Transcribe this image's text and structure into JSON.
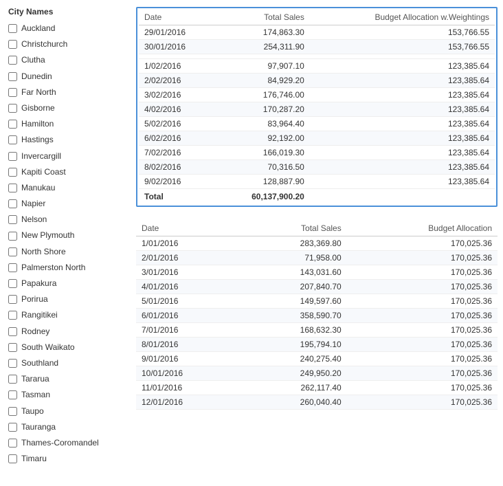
{
  "sidebar": {
    "title": "City Names",
    "cities": [
      {
        "name": "Auckland",
        "checked": false
      },
      {
        "name": "Christchurch",
        "checked": false
      },
      {
        "name": "Clutha",
        "checked": false
      },
      {
        "name": "Dunedin",
        "checked": false
      },
      {
        "name": "Far North",
        "checked": false
      },
      {
        "name": "Gisborne",
        "checked": false
      },
      {
        "name": "Hamilton",
        "checked": false
      },
      {
        "name": "Hastings",
        "checked": false
      },
      {
        "name": "Invercargill",
        "checked": false
      },
      {
        "name": "Kapiti Coast",
        "checked": false
      },
      {
        "name": "Manukau",
        "checked": false
      },
      {
        "name": "Napier",
        "checked": false
      },
      {
        "name": "Nelson",
        "checked": false
      },
      {
        "name": "New Plymouth",
        "checked": false
      },
      {
        "name": "North Shore",
        "checked": false
      },
      {
        "name": "Palmerston North",
        "checked": false
      },
      {
        "name": "Papakura",
        "checked": false
      },
      {
        "name": "Porirua",
        "checked": false
      },
      {
        "name": "Rangitikei",
        "checked": false
      },
      {
        "name": "Rodney",
        "checked": false
      },
      {
        "name": "South Waikato",
        "checked": false
      },
      {
        "name": "Southland",
        "checked": false
      },
      {
        "name": "Tararua",
        "checked": false
      },
      {
        "name": "Tasman",
        "checked": false
      },
      {
        "name": "Taupo",
        "checked": false
      },
      {
        "name": "Tauranga",
        "checked": false
      },
      {
        "name": "Thames-Coromandel",
        "checked": false
      },
      {
        "name": "Timaru",
        "checked": false
      }
    ]
  },
  "table1": {
    "headers": [
      "Date",
      "Total Sales",
      "Budget Allocation w.Weightings"
    ],
    "pre_rows": [
      {
        "date": "29/01/2016",
        "total_sales": "174,863.30",
        "budget": "153,766.55"
      },
      {
        "date": "30/01/2016",
        "total_sales": "254,311.90",
        "budget": "153,766.55"
      },
      {
        "date": "...",
        "total_sales": "...",
        "budget": "..."
      }
    ],
    "rows": [
      {
        "date": "1/02/2016",
        "total_sales": "97,907.10",
        "budget": "123,385.64"
      },
      {
        "date": "2/02/2016",
        "total_sales": "84,929.20",
        "budget": "123,385.64"
      },
      {
        "date": "3/02/2016",
        "total_sales": "176,746.00",
        "budget": "123,385.64"
      },
      {
        "date": "4/02/2016",
        "total_sales": "170,287.20",
        "budget": "123,385.64"
      },
      {
        "date": "5/02/2016",
        "total_sales": "83,964.40",
        "budget": "123,385.64"
      },
      {
        "date": "6/02/2016",
        "total_sales": "92,192.00",
        "budget": "123,385.64"
      },
      {
        "date": "7/02/2016",
        "total_sales": "166,019.30",
        "budget": "123,385.64"
      },
      {
        "date": "8/02/2016",
        "total_sales": "70,316.50",
        "budget": "123,385.64"
      },
      {
        "date": "9/02/2016",
        "total_sales": "128,887.90",
        "budget": "123,385.64"
      }
    ],
    "footer": {
      "label": "Total",
      "total_sales": "60,137,900.20",
      "budget": ""
    }
  },
  "table2": {
    "headers": [
      "Date",
      "Total Sales",
      "Budget Allocation"
    ],
    "rows": [
      {
        "date": "1/01/2016",
        "total_sales": "283,369.80",
        "budget": "170,025.36"
      },
      {
        "date": "2/01/2016",
        "total_sales": "71,958.00",
        "budget": "170,025.36"
      },
      {
        "date": "3/01/2016",
        "total_sales": "143,031.60",
        "budget": "170,025.36"
      },
      {
        "date": "4/01/2016",
        "total_sales": "207,840.70",
        "budget": "170,025.36"
      },
      {
        "date": "5/01/2016",
        "total_sales": "149,597.60",
        "budget": "170,025.36"
      },
      {
        "date": "6/01/2016",
        "total_sales": "358,590.70",
        "budget": "170,025.36"
      },
      {
        "date": "7/01/2016",
        "total_sales": "168,632.30",
        "budget": "170,025.36"
      },
      {
        "date": "8/01/2016",
        "total_sales": "195,794.10",
        "budget": "170,025.36"
      },
      {
        "date": "9/01/2016",
        "total_sales": "240,275.40",
        "budget": "170,025.36"
      },
      {
        "date": "10/01/2016",
        "total_sales": "249,950.20",
        "budget": "170,025.36"
      },
      {
        "date": "11/01/2016",
        "total_sales": "262,117.40",
        "budget": "170,025.36"
      },
      {
        "date": "12/01/2016",
        "total_sales": "260,040.40",
        "budget": "170,025.36"
      }
    ]
  }
}
